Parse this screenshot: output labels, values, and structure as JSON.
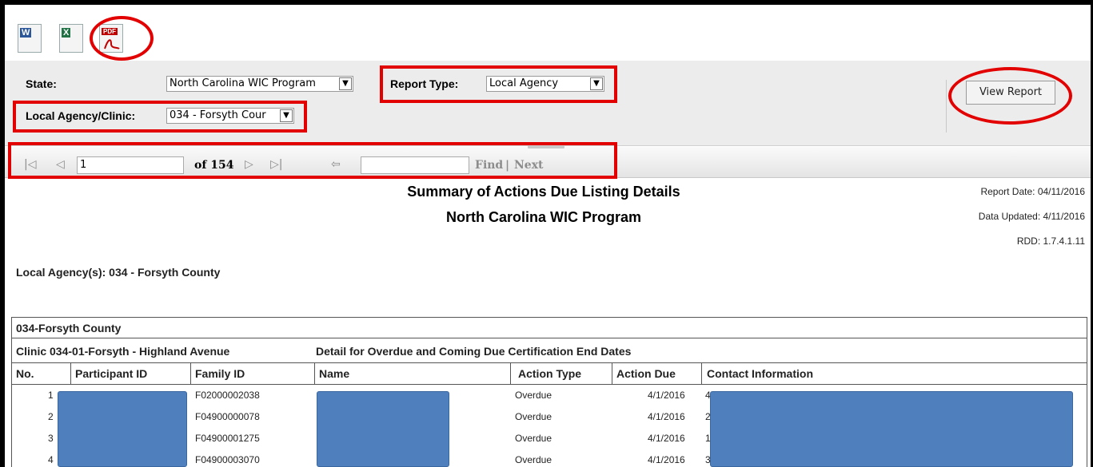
{
  "export_bar": {
    "icons": [
      {
        "name": "word-export-icon",
        "glyph": "W",
        "color": "#2b579a"
      },
      {
        "name": "excel-export-icon",
        "glyph": "X",
        "color": "#217346"
      },
      {
        "name": "pdf-export-icon",
        "glyph": "PDF",
        "color": "#c00000"
      }
    ]
  },
  "params": {
    "state_label": "State:",
    "state_value": "North Carolina WIC Program",
    "report_type_label": "Report Type:",
    "report_type_value": "Local Agency",
    "agency_label": "Local Agency/Clinic:",
    "agency_value": "034 - Forsyth Cour",
    "view_report": "View Report",
    "dropdown_arrow": "▼"
  },
  "toolbar": {
    "first_icon": "|◁",
    "prev_icon": "◁",
    "page_value": "1",
    "of_pages": "of 154",
    "next_icon": "▷",
    "last_icon": "▷|",
    "back_icon": "⇦",
    "find_value": "",
    "find": "Find",
    "separator": "|",
    "next": "Next"
  },
  "report": {
    "title": "Summary of Actions Due Listing Details",
    "subtitle": "North Carolina WIC Program",
    "report_date": "Report Date: 04/11/2016",
    "data_updated": "Data Updated: 4/11/2016",
    "rdd": "RDD: 1.7.4.1.11",
    "local_agency": "Local Agency(s):  034 - Forsyth County",
    "group_header": "034-Forsyth County",
    "clinic": "Clinic 034-01-Forsyth - Highland Avenue",
    "detail": "Detail for Overdue and Coming Due Certification End Dates",
    "columns": [
      "No.",
      "Participant ID",
      "Family ID",
      "Name",
      "Action Type",
      "Action Due",
      "Contact Information"
    ],
    "rows": [
      {
        "no": "1",
        "family_id": "F02000002038",
        "action_type": "Overdue",
        "action_due": "4/1/2016",
        "contact": "4"
      },
      {
        "no": "2",
        "family_id": "F04900000078",
        "action_type": "Overdue",
        "action_due": "4/1/2016",
        "contact": "2"
      },
      {
        "no": "3",
        "family_id": "F04900001275",
        "action_type": "Overdue",
        "action_due": "4/1/2016",
        "contact": "1"
      },
      {
        "no": "4",
        "family_id": "F04900003070",
        "action_type": "Overdue",
        "action_due": "4/1/2016",
        "contact": "3"
      }
    ]
  },
  "colors": {
    "annotation_red": "#e30000",
    "redaction_blue": "#4f7fbd"
  }
}
